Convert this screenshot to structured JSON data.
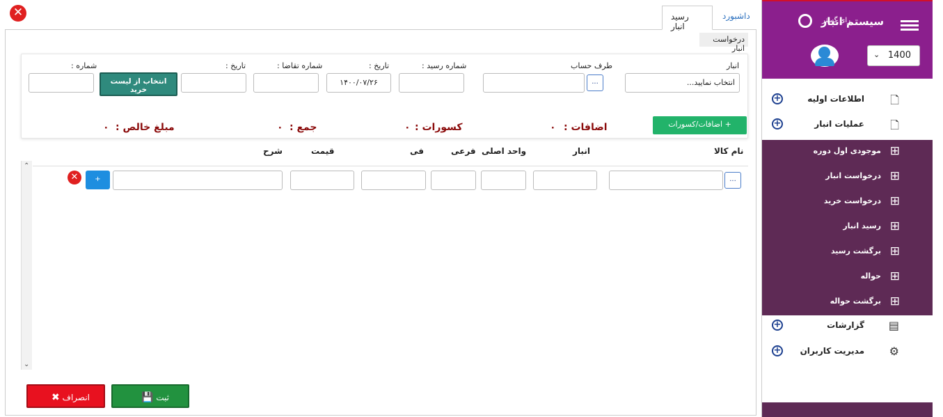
{
  "sidebar": {
    "title": "سیستم انبار",
    "subtitle": "رای گستر",
    "year": "1400",
    "menu": [
      {
        "label": "اطلاعات اولیه"
      },
      {
        "label": "عملیات انبار"
      }
    ],
    "submenu": [
      {
        "label": "موجودی اول دوره"
      },
      {
        "label": "درخواست انبار"
      },
      {
        "label": "درخواست خرید"
      },
      {
        "label": "رسید انبار"
      },
      {
        "label": "برگشت رسید"
      },
      {
        "label": "حواله"
      },
      {
        "label": "برگشت حواله"
      }
    ],
    "menu_bottom": [
      {
        "label": "گزارشات"
      },
      {
        "label": "مدیریت کاربران"
      }
    ]
  },
  "tabs": {
    "dashboard": "داشبورد",
    "receipt": "رسید انبار"
  },
  "section_title": "درخواست انبار",
  "form": {
    "warehouse_label": "انبار",
    "warehouse_value": "انتخاب نمایید...",
    "account_label": "طرف حساب",
    "receipt_no_label": "شماره رسید :",
    "date_label": "تاریخ :",
    "date_value": "۱۴۰۰/۰۷/۲۶",
    "request_no_label": "شماره تقاضا :",
    "date2_label": "تاریخ :",
    "number_label": "شماره :",
    "select_list_button": "انتخاب از لیست خرید",
    "add_deduct_button": "اضافات/کسورات +",
    "dots": "..."
  },
  "summary": {
    "additions": "اضافات :",
    "additions_value": "۰",
    "deductions": "کسورات :",
    "deductions_value": "۰",
    "total": "جمع :",
    "total_value": "۰",
    "net": "مبلغ خالص :",
    "net_value": "۰"
  },
  "grid": {
    "headers": [
      "نام کالا",
      "انبار",
      "واحد اصلی",
      "فرعی",
      "فی",
      "قیمت",
      "شرح"
    ],
    "row_add": "+"
  },
  "actions": {
    "save": "ثبت",
    "cancel": "انصراف"
  },
  "colors": {
    "sidebar_header": "#8b1f8d",
    "submenu_bg": "#5e2a55",
    "save": "#22923f",
    "cancel": "#e8111f"
  }
}
